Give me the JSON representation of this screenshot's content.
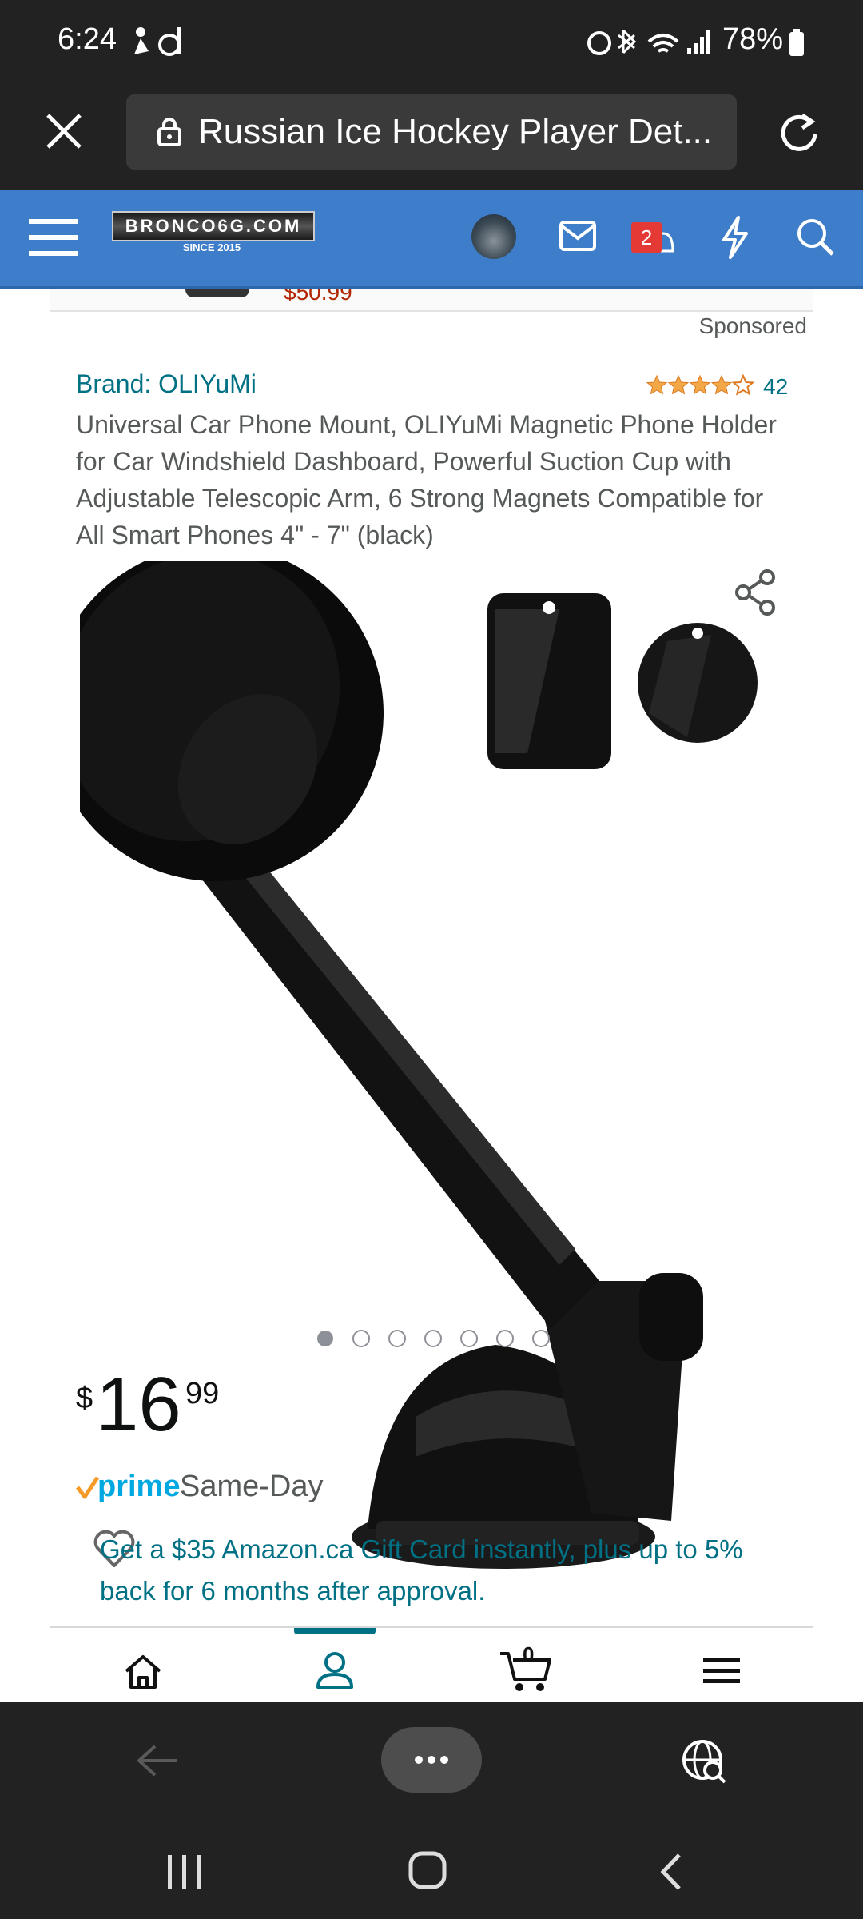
{
  "status_bar": {
    "time": "6:24",
    "battery": "78%"
  },
  "browser": {
    "url_title": "Russian Ice Hockey Player Det...",
    "close_icon": "close-icon",
    "refresh_icon": "refresh-icon"
  },
  "site_header": {
    "logo_text": "BRONCO6G.COM",
    "logo_subtitle": "SINCE 2015",
    "notification_count": "2"
  },
  "content": {
    "previous_price": "$50.99",
    "sponsored": "Sponsored",
    "brand": "Brand: OLIYuMi",
    "rating_count": "42",
    "rating_stars": 4,
    "title": "Universal Car Phone Mount, OLIYuMi Magnetic Phone Holder for Car Windshield Dashboard, Powerful Suction Cup with Adjustable Telescopic Arm, 6 Strong Magnets Compatible for All Smart Phones 4\" - 7\" (black)",
    "price_symbol": "$",
    "price_whole": "16",
    "price_fraction": "99",
    "prime_label": "prime",
    "same_day": "Same-Day",
    "offer": "Get a $35 Amazon.ca Gift Card instantly, plus up to 5% back for 6 months after approval."
  },
  "web_nav": {
    "cart_count": "0"
  },
  "colors": {
    "header_blue": "#3e7dca",
    "link_teal": "#007185",
    "price_red": "#b12704",
    "notification_red": "#e53935"
  }
}
